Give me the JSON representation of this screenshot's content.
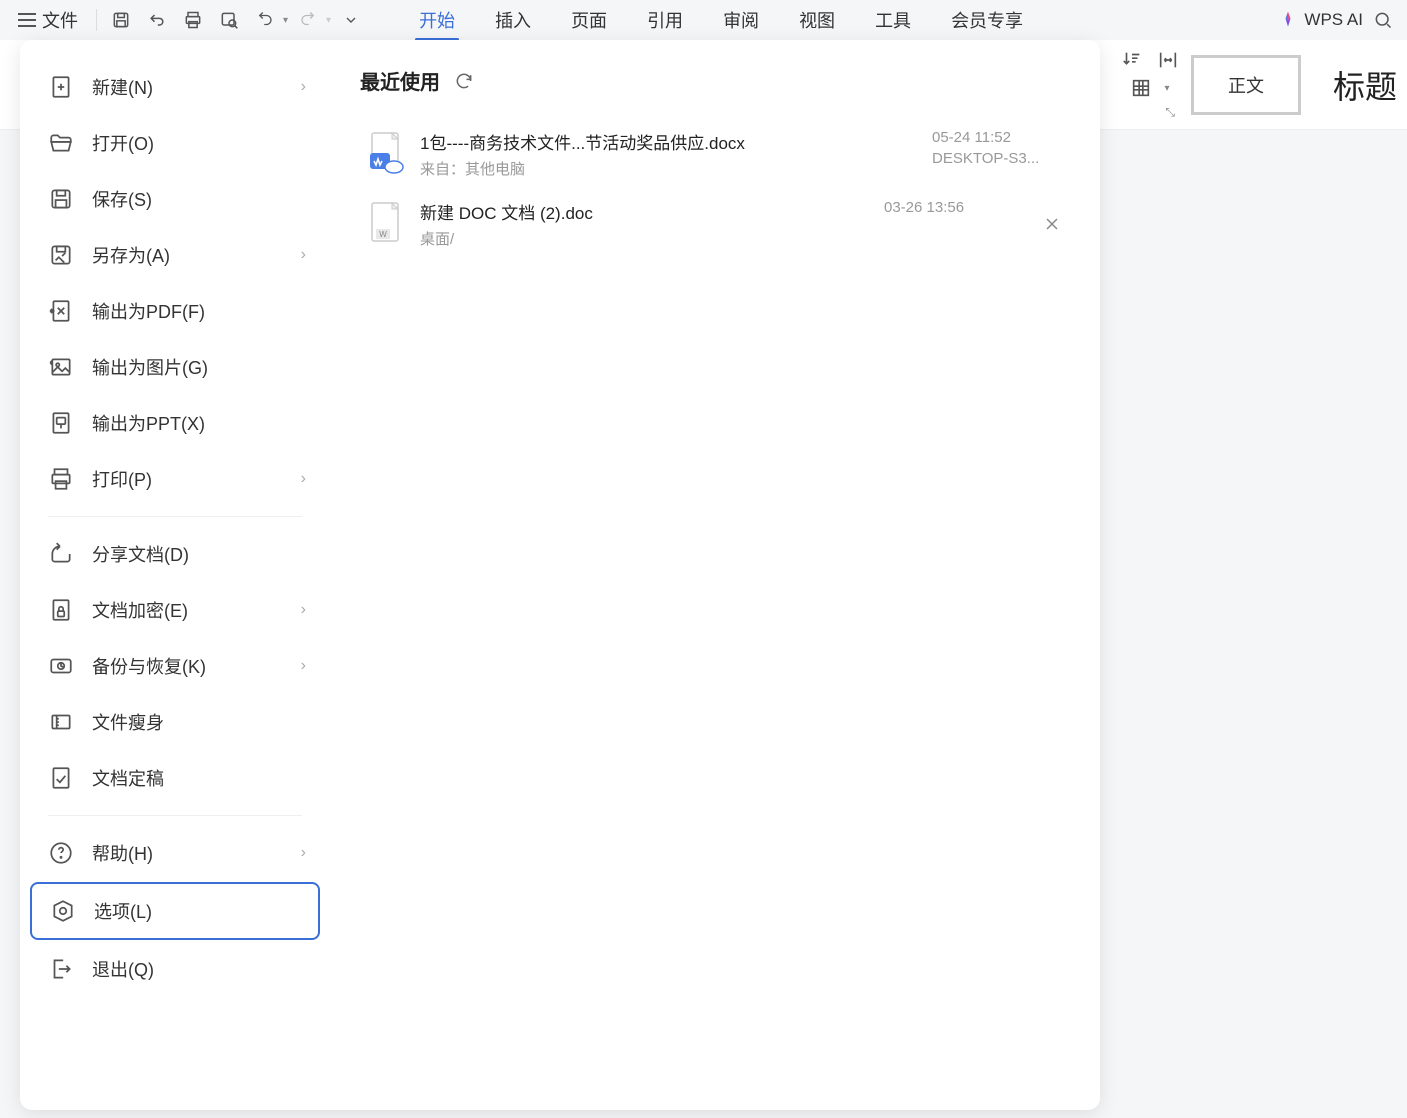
{
  "toolbar": {
    "file_label": "文件"
  },
  "tabs": [
    "开始",
    "插入",
    "页面",
    "引用",
    "审阅",
    "视图",
    "工具",
    "会员专享"
  ],
  "active_tab_index": 0,
  "wps_ai_label": "WPS AI",
  "ribbon": {
    "style_normal": "正文",
    "title_heading": "标题"
  },
  "sidebar": {
    "items": [
      {
        "label": "新建(N)",
        "icon": "plus-doc",
        "chevron": true
      },
      {
        "label": "打开(O)",
        "icon": "folder-open",
        "chevron": false
      },
      {
        "label": "保存(S)",
        "icon": "save",
        "chevron": false
      },
      {
        "label": "另存为(A)",
        "icon": "save-as",
        "chevron": true
      },
      {
        "label": "输出为PDF(F)",
        "icon": "pdf",
        "chevron": false
      },
      {
        "label": "输出为图片(G)",
        "icon": "image",
        "chevron": false
      },
      {
        "label": "输出为PPT(X)",
        "icon": "ppt",
        "chevron": false
      },
      {
        "label": "打印(P)",
        "icon": "print",
        "chevron": true
      }
    ],
    "items2": [
      {
        "label": "分享文档(D)",
        "icon": "share",
        "chevron": false
      },
      {
        "label": "文档加密(E)",
        "icon": "lock",
        "chevron": true
      },
      {
        "label": "备份与恢复(K)",
        "icon": "backup",
        "chevron": true
      },
      {
        "label": "文件瘦身",
        "icon": "compress",
        "chevron": false
      },
      {
        "label": "文档定稿",
        "icon": "finalize",
        "chevron": false
      }
    ],
    "items3": [
      {
        "label": "帮助(H)",
        "icon": "help",
        "chevron": true
      },
      {
        "label": "选项(L)",
        "icon": "settings",
        "chevron": false,
        "selected": true
      },
      {
        "label": "退出(Q)",
        "icon": "exit",
        "chevron": false
      }
    ]
  },
  "content": {
    "title": "最近使用",
    "files": [
      {
        "name": "1包----商务技术文件...节活动奖品供应.docx",
        "source": "来自：其他电脑",
        "time": "05-24 11:52",
        "device": "DESKTOP-S3...",
        "type": "docx-cloud"
      },
      {
        "name": "新建 DOC 文档 (2).doc",
        "source": "桌面/",
        "time": "03-26 13:56",
        "device": "",
        "type": "doc",
        "show_close": true
      }
    ]
  }
}
